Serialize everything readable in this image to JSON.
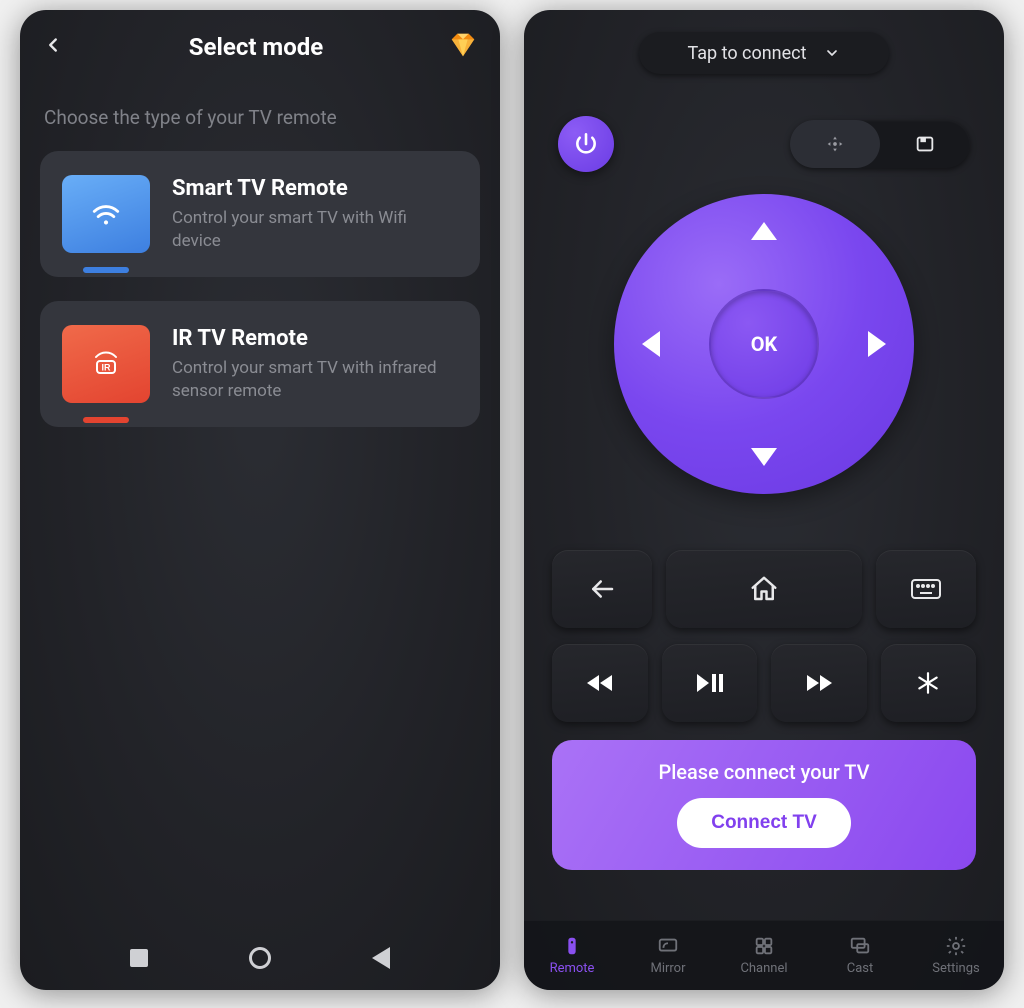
{
  "left": {
    "title": "Select mode",
    "subtitle": "Choose the type of your TV remote",
    "options": [
      {
        "title": "Smart TV Remote",
        "desc": "Control your smart TV with Wifi device"
      },
      {
        "title": "IR TV Remote",
        "desc": "Control your smart TV with infrared sensor remote"
      }
    ]
  },
  "right": {
    "connect_pill": "Tap to connect",
    "dpad_ok": "OK",
    "banner_msg": "Please connect your TV",
    "banner_btn": "Connect TV",
    "nav": [
      {
        "label": "Remote",
        "active": true
      },
      {
        "label": "Mirror",
        "active": false
      },
      {
        "label": "Channel",
        "active": false
      },
      {
        "label": "Cast",
        "active": false
      },
      {
        "label": "Settings",
        "active": false
      }
    ]
  },
  "icons": {
    "ir_label": "IR"
  }
}
